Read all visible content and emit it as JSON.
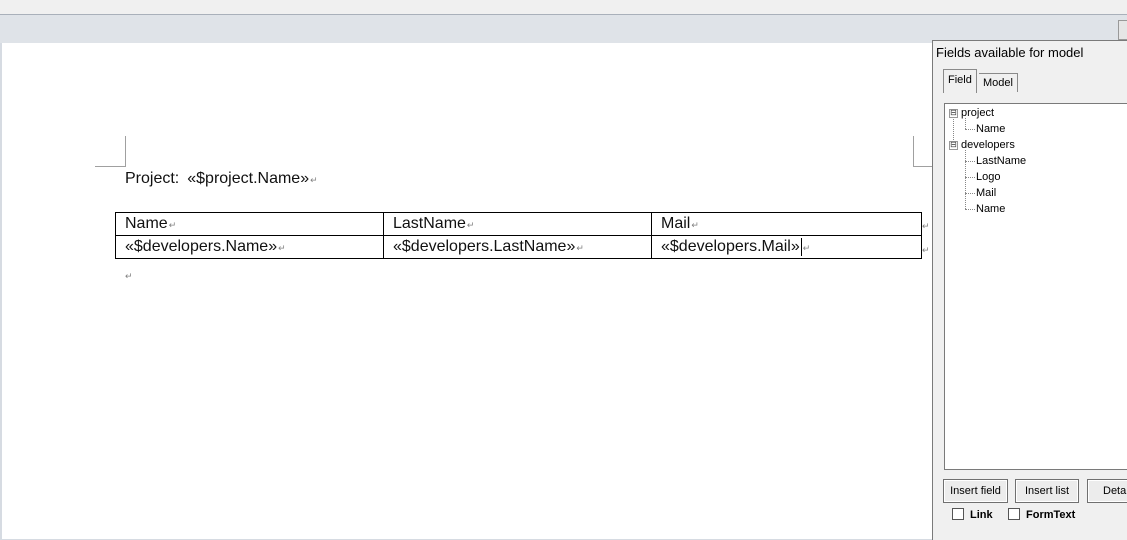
{
  "document": {
    "project_label": "Project:",
    "project_field": "«$project.Name»",
    "table": {
      "headers": [
        "Name",
        "LastName",
        "Mail"
      ],
      "row": [
        "«$developers.Name»",
        "«$developers.LastName»",
        "«$developers.Mail»"
      ]
    }
  },
  "panel": {
    "title": "Fields available for model",
    "tabs": [
      "Field",
      "Model"
    ],
    "tree": [
      {
        "label": "project",
        "children": [
          "Name"
        ]
      },
      {
        "label": "developers",
        "children": [
          "LastName",
          "Logo",
          "Mail",
          "Name"
        ]
      }
    ],
    "buttons": {
      "insert_field": "Insert field",
      "insert_list": "Insert list",
      "details": "Deta"
    },
    "checkboxes": {
      "link": "Link",
      "formtext": "FormText"
    }
  },
  "marks": {
    "paragraph": "↵",
    "expander": "⊟"
  }
}
